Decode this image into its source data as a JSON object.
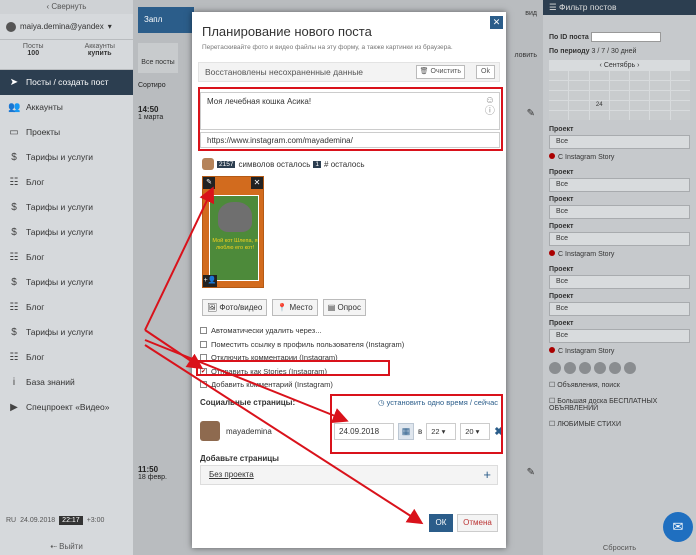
{
  "sidebar": {
    "collapse": "Свернуть",
    "user": "maiya.demina@yandex",
    "stats": [
      {
        "label": "Посты",
        "value": "100"
      },
      {
        "label": "Аккаунты",
        "value": "купить"
      }
    ],
    "items": [
      {
        "label": "Посты / создать пост",
        "icon": "paper-plane-icon",
        "active": true
      },
      {
        "label": "Аккаунты",
        "icon": "users-icon"
      },
      {
        "label": "Проекты",
        "icon": "folders-icon"
      },
      {
        "label": "Тарифы и услуги",
        "icon": "dollar-icon"
      },
      {
        "label": "Блог",
        "icon": "blog-icon"
      },
      {
        "label": "Тарифы и услуги",
        "icon": "dollar-icon"
      },
      {
        "label": "Тарифы и услуги",
        "icon": "dollar-icon"
      },
      {
        "label": "Блог",
        "icon": "blog-icon"
      },
      {
        "label": "Тарифы и услуги",
        "icon": "dollar-icon"
      },
      {
        "label": "Блог",
        "icon": "blog-icon"
      },
      {
        "label": "Тарифы и услуги",
        "icon": "dollar-icon"
      },
      {
        "label": "Блог",
        "icon": "blog-icon"
      },
      {
        "label": "База знаний",
        "icon": "info-icon"
      },
      {
        "label": "Спецпроект «Видео»",
        "icon": "video-icon"
      }
    ],
    "bottom": {
      "lang": "RU",
      "date": "24.09.2018",
      "time": "22:17",
      "tz": "+3:00"
    },
    "logout": "Выйти"
  },
  "center": {
    "top_button": "Запл",
    "top_tab": "Все посты",
    "top_right": "вид",
    "right_button": "ловить",
    "sort": "Сортиро",
    "posts": [
      {
        "time": "14:50",
        "date": "1 марта"
      },
      {
        "time": "11:50",
        "date": "18 февр."
      }
    ]
  },
  "filter": {
    "title": "Фильтр постов",
    "by_id": "По ID поста",
    "period_label": "По периоду",
    "period_values": "3 / 7 / 30 дней",
    "month": "Сентябрь",
    "today": "24",
    "project_label": "Проект",
    "select_all": "Все",
    "instagram_story": "С Instagram Story",
    "ads": "Объявления, поиск",
    "big_board": "Большая доска БЕСПЛАТНЫХ ОБЪЯВЛЕНИЙ",
    "fav": "ЛЮБИМЫЕ СТИХИ",
    "reset": "Сбросить"
  },
  "modal": {
    "title": "Планирование нового поста",
    "subtitle": "Перетаскивайте фото и видео файлы на эту форму, а также картинки из браузера.",
    "restored": "Восстановлены несохраненные данные",
    "clear": "Очистить",
    "ok_small": "Ok",
    "text": "Моя лечебная кошка Асика!",
    "link": "https://www.instagram.com/mayademina/",
    "chars_left_count": "2157",
    "chars_left_label": "символов осталось",
    "hash_count": "1",
    "hash_label": "# осталось",
    "photo_caption": "Мой кот Шлепа, я люблю его кот!",
    "btn_photo": "Фото/видео",
    "btn_place": "Место",
    "btn_poll": "Опрос",
    "options": [
      {
        "label": "Автоматически удалить через...",
        "checked": false
      },
      {
        "label": "Поместить ссылку в профиль пользователя (Instagram)",
        "checked": false
      },
      {
        "label": "Отключить комментарии (Instagram)",
        "checked": false
      },
      {
        "label": "Отправить как Stories (Instagram)",
        "checked": true
      },
      {
        "label": "Добавить комментарий (Instagram)",
        "checked": false
      }
    ],
    "social_title": "Социальные страницы:",
    "set_one_time": "установить одно время",
    "now": "сейчас",
    "account": "mayademina",
    "date": "24.09.2018",
    "in": "в",
    "hour": "22",
    "minute": "20",
    "add_pages": "Добавьте страницы",
    "no_project": "Без проекта",
    "ok": "ОК",
    "cancel": "Отмена"
  },
  "colors": {
    "accent": "#2b5d8a",
    "sidebar_active": "#2c3e50",
    "highlight": "#d9121b"
  }
}
